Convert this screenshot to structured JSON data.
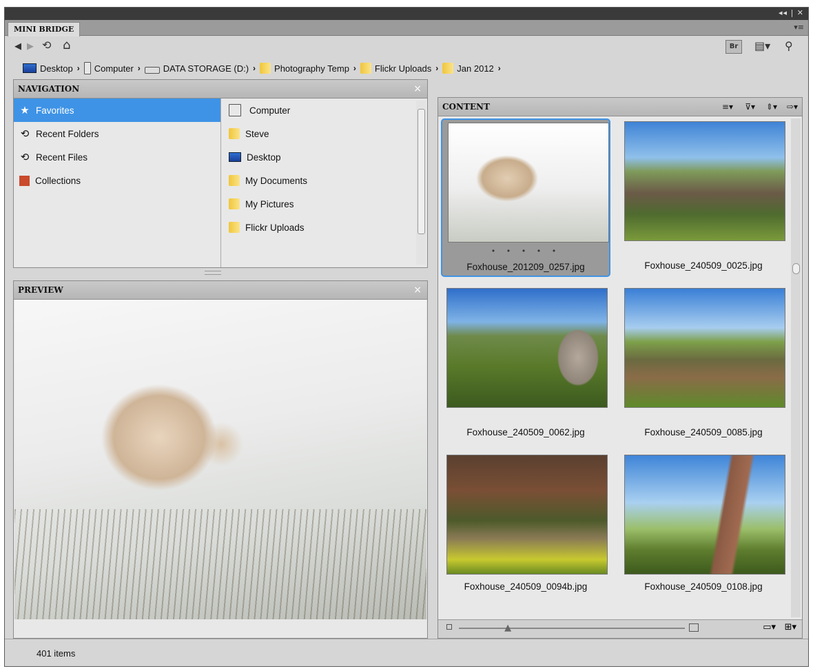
{
  "panel_title": "MINI BRIDGE",
  "toolbar": {
    "back_icon": "back-arrow-icon",
    "forward_icon": "forward-arrow-icon",
    "refresh_icon": "recent-refresh-icon",
    "home_icon": "home-icon",
    "bridge_label": "Br",
    "view_icon": "document-menu-icon",
    "search_icon": "search-icon"
  },
  "breadcrumb": [
    {
      "label": "Desktop",
      "icon": "desktop"
    },
    {
      "label": "Computer",
      "icon": "computer"
    },
    {
      "label": "DATA STORAGE (D:)",
      "icon": "drive"
    },
    {
      "label": "Photography Temp",
      "icon": "folder"
    },
    {
      "label": "Flickr Uploads",
      "icon": "folder"
    },
    {
      "label": "Jan 2012",
      "icon": "folder"
    }
  ],
  "navigation": {
    "title": "NAVIGATION",
    "left": [
      {
        "label": "Favorites",
        "icon": "★",
        "selected": true
      },
      {
        "label": "Recent Folders",
        "icon": "⟲"
      },
      {
        "label": "Recent Files",
        "icon": "⟲"
      },
      {
        "label": "Collections",
        "icon": "collections"
      }
    ],
    "right": [
      {
        "label": "Computer"
      },
      {
        "label": "Steve"
      },
      {
        "label": "Desktop"
      },
      {
        "label": "My Documents"
      },
      {
        "label": "My Pictures"
      },
      {
        "label": "Flickr Uploads"
      }
    ]
  },
  "preview": {
    "title": "PREVIEW"
  },
  "content": {
    "title": "CONTENT",
    "items": [
      {
        "name": "Foxhouse_201209_0257.jpg",
        "selected": true,
        "rating": "• • • • •"
      },
      {
        "name": "Foxhouse_240509_0025.jpg"
      },
      {
        "name": "Foxhouse_240509_0062.jpg"
      },
      {
        "name": "Foxhouse_240509_0085.jpg"
      },
      {
        "name": "Foxhouse_240509_0094b.jpg"
      },
      {
        "name": "Foxhouse_240509_0108.jpg"
      }
    ],
    "zoom_level": 0.22
  },
  "status": {
    "count": "401 items"
  }
}
